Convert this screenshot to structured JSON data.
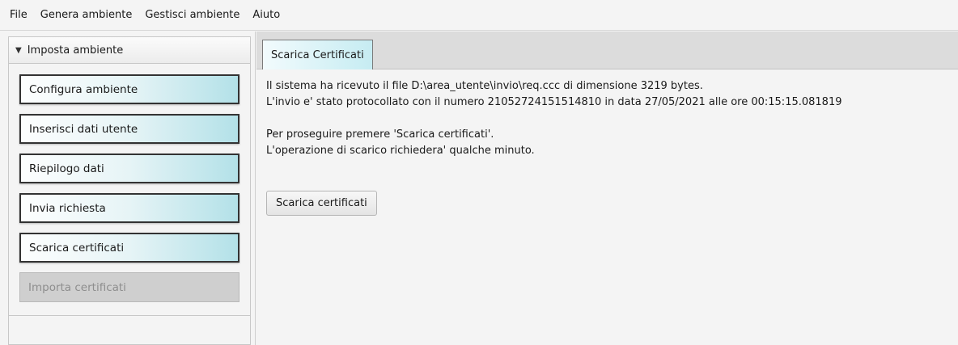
{
  "menubar": {
    "items": [
      "File",
      "Genera ambiente",
      "Gestisci ambiente",
      "Aiuto"
    ]
  },
  "sidebar": {
    "header": {
      "arrow": "▼",
      "title": "Imposta ambiente"
    },
    "items": [
      {
        "label": "Configura ambiente",
        "enabled": true
      },
      {
        "label": "Inserisci dati utente",
        "enabled": true
      },
      {
        "label": "Riepilogo dati",
        "enabled": true
      },
      {
        "label": "Invia richiesta",
        "enabled": true
      },
      {
        "label": "Scarica certificati",
        "enabled": true
      },
      {
        "label": "Importa certificati",
        "enabled": false
      }
    ]
  },
  "main": {
    "tab_label": "Scarica Certificati",
    "lines": [
      "Il sistema ha ricevuto il file D:\\area_utente\\invio\\req.ccc di dimensione 3219 bytes.",
      "L'invio e' stato protocollato con il numero 21052724151514810 in data 27/05/2021 alle ore 00:15:15.081819",
      "Per proseguire premere 'Scarica certificati'.",
      "L'operazione di scarico richiedera' qualche minuto."
    ],
    "action_button": "Scarica certificati"
  },
  "colors": {
    "button_gradient_end": "#b3e1e8",
    "tab_gradient_end": "#c6ecf2",
    "disabled_bg": "#cfcfcf"
  }
}
